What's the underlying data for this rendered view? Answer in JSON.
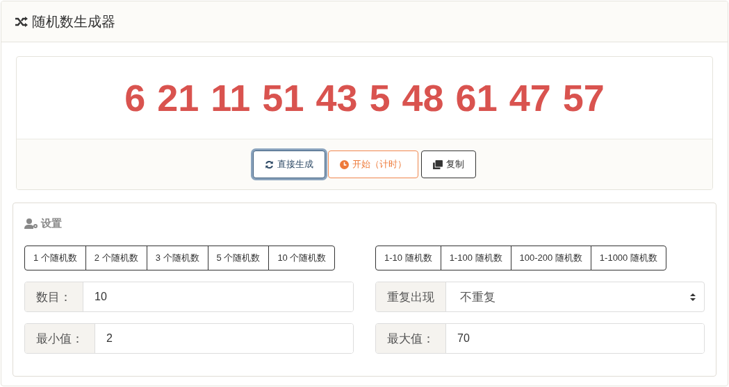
{
  "header": {
    "title": "随机数生成器"
  },
  "result": {
    "numbers": "6 21 11 51 43 5 48 61 47 57"
  },
  "actions": [
    {
      "kind": "refresh",
      "label": "直接生成",
      "focused": true
    },
    {
      "kind": "clock",
      "label": "开始（计时）",
      "focused": false
    },
    {
      "kind": "copy",
      "label": "复制",
      "focused": false
    }
  ],
  "settings": {
    "title": "设置",
    "count_presets": [
      "1 个随机数",
      "2 个随机数",
      "3 个随机数",
      "5 个随机数",
      "10 个随机数"
    ],
    "range_presets": [
      "1-10 随机数",
      "1-100 随机数",
      "100-200 随机数",
      "1-1000 随机数"
    ],
    "fields": [
      {
        "kind": "input",
        "label": "数目：",
        "value": "10"
      },
      {
        "kind": "select",
        "label": "重复出现",
        "value": "不重复"
      },
      {
        "kind": "input",
        "label": "最小值：",
        "value": "2"
      },
      {
        "kind": "input",
        "label": "最大值：",
        "value": "70"
      }
    ]
  }
}
